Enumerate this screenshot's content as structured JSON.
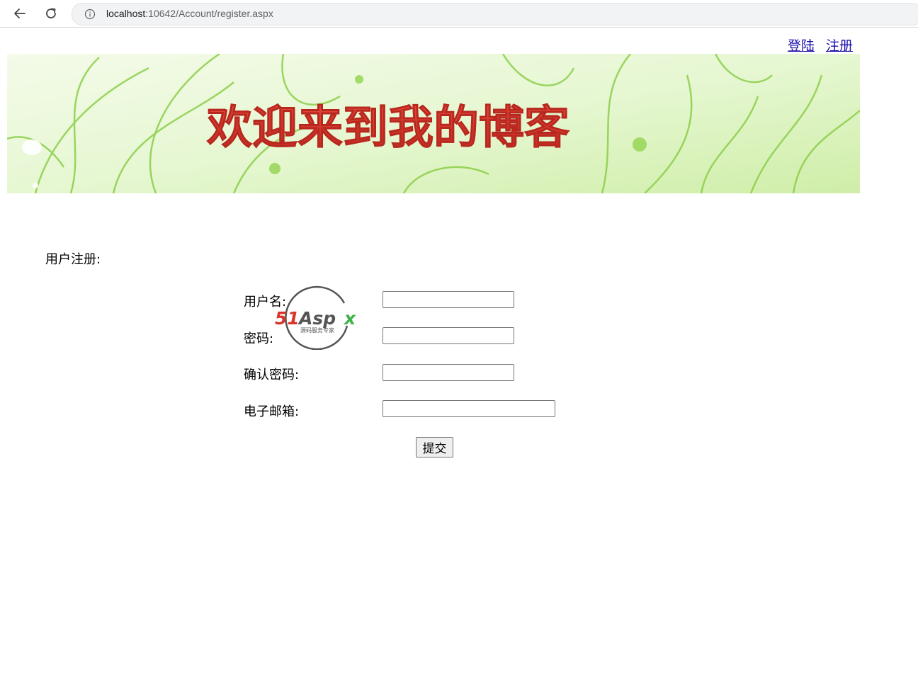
{
  "browser": {
    "url_host": "localhost",
    "url_rest": ":10642/Account/register.aspx"
  },
  "header": {
    "login_link": "登陆",
    "register_link": "注册"
  },
  "banner": {
    "title": "欢迎来到我的博客"
  },
  "form": {
    "heading": "用户注册:",
    "username_label": "用户名:",
    "password_label": "密码:",
    "confirm_label": "确认密码:",
    "email_label": "电子邮箱:",
    "username_value": "",
    "password_value": "",
    "confirm_value": "",
    "email_value": "",
    "submit_label": "提交"
  },
  "watermark": {
    "brand": "51Aspx",
    "tagline": "源码服务专家"
  },
  "colors": {
    "link": "#1a0dab",
    "banner_text": "#d8352a",
    "banner_bg": "#dff5c6",
    "stem": "#8ccf4a"
  }
}
